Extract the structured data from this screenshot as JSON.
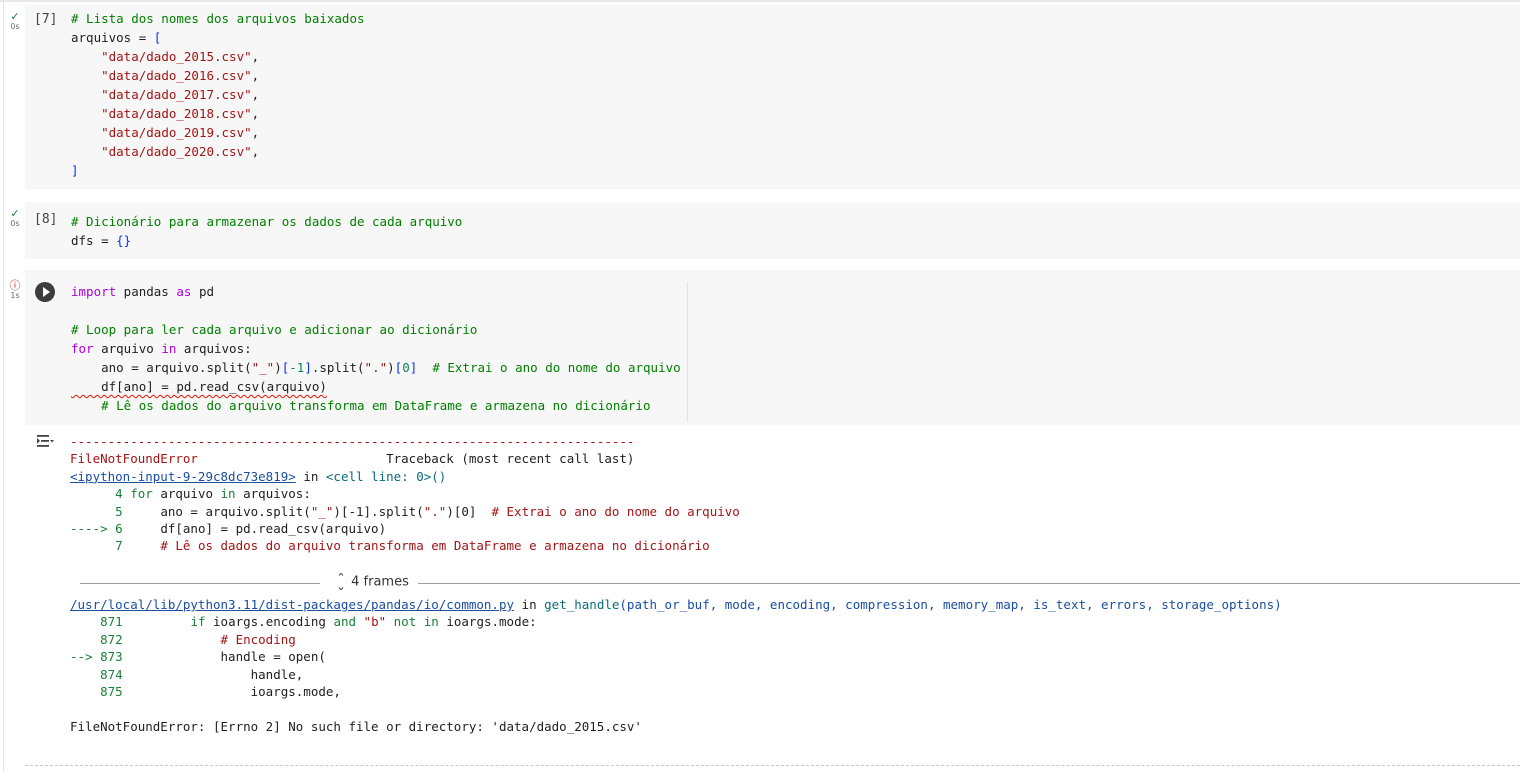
{
  "cells": [
    {
      "count": "[7]",
      "status_time": "0s",
      "lines": [
        "# Lista dos nomes dos arquivos baixados",
        "arquivos = [",
        "    \"data/dado_2015.csv\",",
        "    \"data/dado_2016.csv\",",
        "    \"data/dado_2017.csv\",",
        "    \"data/dado_2018.csv\",",
        "    \"data/dado_2019.csv\",",
        "    \"data/dado_2020.csv\",",
        "]"
      ]
    },
    {
      "count": "[8]",
      "status_time": "0s",
      "lines": [
        "# Dicionário para armazenar os dados de cada arquivo",
        "dfs = {}"
      ]
    },
    {
      "status_time": "1s",
      "lines": [
        "import pandas as pd",
        "",
        "# Loop para ler cada arquivo e adicionar ao dicionário",
        "for arquivo in arquivos:",
        "    ano = arquivo.split(\"_\")[-1].split(\".\")[0]  # Extrai o ano do nome do arquivo",
        "    df[ano] = pd.read_csv(arquivo)",
        "    # Lê os dados do arquivo transforma em DataFrame e armazena no dicionário"
      ]
    }
  ],
  "output": {
    "separator": "---------------------------------------------------------------------------",
    "error_name": "FileNotFoundError",
    "traceback_label": "Traceback (most recent call last)",
    "input_link": "<ipython-input-9-29c8dc73e819>",
    "in_word": "in",
    "cell_ref": "<cell line: 0>()",
    "frame1": [
      {
        "prefix": "      4 ",
        "code": "for arquivo in arquivos:"
      },
      {
        "prefix": "      5 ",
        "code": "    ano = arquivo.split(\"_\")[-1].split(\".\")[0]  # Extrai o ano do nome do arquivo"
      },
      {
        "prefix": "----> 6 ",
        "code": "    df[ano] = pd.read_csv(arquivo)"
      },
      {
        "prefix": "      7 ",
        "code": "    # Lê os dados do arquivo transforma em DataFrame e armazena no dicionário"
      }
    ],
    "frames_toggle": "4 frames",
    "lib_path": "/usr/local/lib/python3.11/dist-packages/pandas/io/common.py",
    "lib_func": "get_handle",
    "lib_args": "(path_or_buf, mode, encoding, compression, memory_map, is_text, errors, storage_options)",
    "frame2": [
      {
        "prefix": "    871 ",
        "code": "        if ioargs.encoding and \"b\" not in ioargs.mode:"
      },
      {
        "prefix": "    872 ",
        "code": "            # Encoding"
      },
      {
        "prefix": "--> 873 ",
        "code": "            handle = open("
      },
      {
        "prefix": "    874 ",
        "code": "                handle,"
      },
      {
        "prefix": "    875 ",
        "code": "                ioargs.mode,"
      }
    ],
    "final_error": "FileNotFoundError: [Errno 2] No such file or directory: 'data/dado_2015.csv'"
  },
  "icons": {
    "ok": "check-icon",
    "error": "error-circle-icon",
    "run": "run-button-icon",
    "output": "output-actions-icon",
    "frames": "expand-collapse-icon"
  }
}
